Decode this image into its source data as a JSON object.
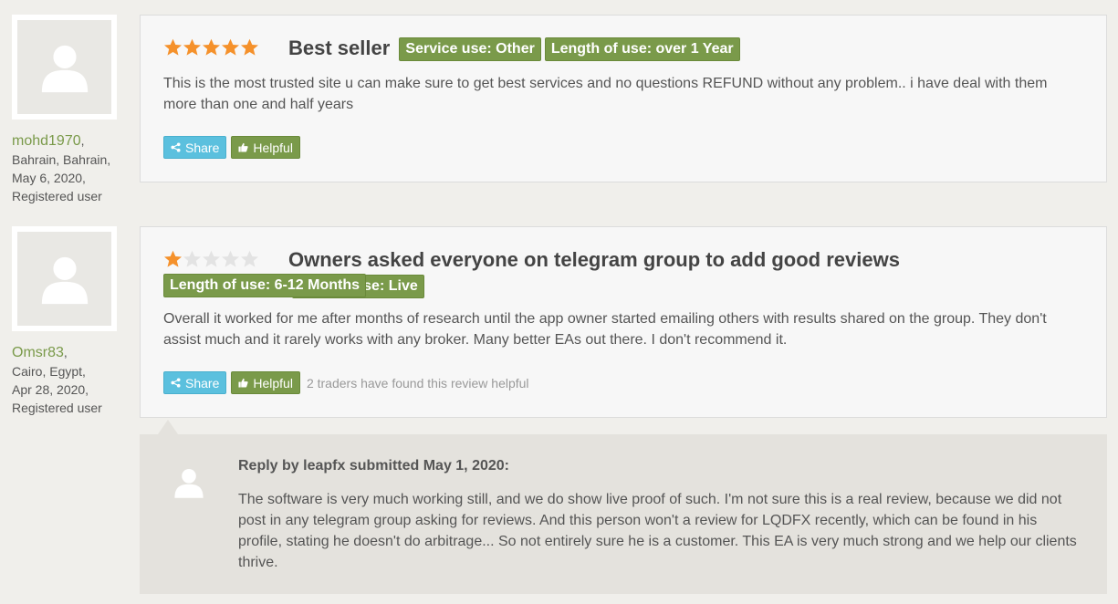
{
  "reviews": [
    {
      "user": {
        "name": "mohd1970",
        "location": "Bahrain, Bahrain,",
        "date": "May 6, 2020,",
        "role": "Registered user"
      },
      "rating": 5,
      "title": "Best seller",
      "badges": [
        "Service use: Other",
        "Length of use: over 1 Year"
      ],
      "body": "This is the most trusted site u can make sure to get best services and no questions REFUND without any problem.. i have deal with them more than one and half years",
      "share_label": "Share",
      "helpful_label": "Helpful",
      "helpful_count_text": ""
    },
    {
      "user": {
        "name": "Omsr83",
        "location": "Cairo, Egypt,",
        "date": "Apr 28, 2020,",
        "role": "Registered user"
      },
      "rating": 1,
      "title": "Owners asked everyone on telegram group to add good reviews",
      "badges": [
        "Service use: Live",
        "Length of use: 6-12 Months"
      ],
      "body": "Overall it worked for me after months of research until the app owner started emailing others with results shared on the group. They don't assist much and it rarely works with any broker. Many better EAs out there. I don't recommend it.",
      "share_label": "Share",
      "helpful_label": "Helpful",
      "helpful_count_text": "2 traders have found this review helpful"
    }
  ],
  "reply": {
    "title": "Reply by leapfx submitted May 1, 2020:",
    "body": "The software is very much working still, and we do show live proof of such. I'm not sure this is a real review, because we did not post in any telegram group asking for reviews. And this person won't a review for LQDFX recently, which can be found in his profile, stating he doesn't do arbitrage... So not entirely sure he is a customer. This EA is very much strong and we help our clients thrive."
  },
  "colors": {
    "star_on": "#f5912b",
    "star_off": "#e3e3e3",
    "accent_green": "#7a9a4a",
    "share_blue": "#5bc0de"
  },
  "icons": {
    "avatar": "user-silhouette-icon",
    "share": "share-icon",
    "helpful": "thumbs-up-icon",
    "star": "star-icon"
  }
}
